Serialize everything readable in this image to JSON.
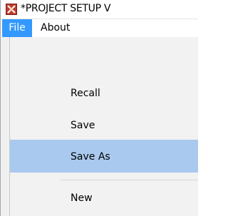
{
  "window": {
    "title": "*PROJECT SETUP  V"
  },
  "icons": {
    "app_icon": "app-logo-icon"
  },
  "menubar": {
    "items": [
      {
        "label": "File",
        "active": true
      },
      {
        "label": "About",
        "active": false
      }
    ]
  },
  "dropdown": {
    "items": [
      {
        "label": "Recall",
        "highlighted": false
      },
      {
        "label": "Save",
        "highlighted": false
      },
      {
        "label": "Save As",
        "highlighted": true
      },
      {
        "label": "New",
        "highlighted": false
      }
    ]
  },
  "colors": {
    "menu_active_bg": "#3399ff",
    "menu_active_text": "#ffffff",
    "item_highlight_bg": "#a9c9ef",
    "dropdown_bg": "#f2f2f2"
  }
}
